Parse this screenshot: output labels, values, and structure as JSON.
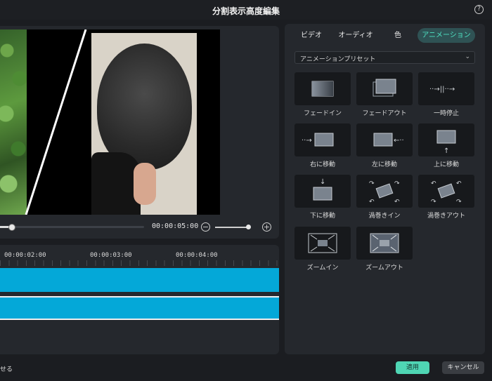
{
  "window": {
    "title": "分割表示高度編集",
    "help_icon": "?"
  },
  "preview": {
    "time_display": "00:00:05:00",
    "zoom_out_symbol": "−",
    "zoom_in_symbol": "+",
    "playhead_progress": 0.085,
    "zoom_level": 0.88
  },
  "timeline": {
    "ticks": [
      "00:00:02:00",
      "00:00:03:00",
      "00:00:04:00"
    ],
    "track_color": "#04a8d8"
  },
  "tabs": [
    {
      "label": "ビデオ"
    },
    {
      "label": "オーディオ"
    },
    {
      "label": "色"
    },
    {
      "label": "アニメーション"
    }
  ],
  "active_tab": "アニメーション",
  "preset_dropdown": {
    "label": "アニメーションプリセット",
    "chevron_icon": "chevron-down-icon"
  },
  "presets": [
    {
      "label": "フェードイン",
      "icon": "fade-in-icon"
    },
    {
      "label": "フェードアウト",
      "icon": "fade-out-icon"
    },
    {
      "label": "一時停止",
      "icon": "pause-icon"
    },
    {
      "label": "右に移動",
      "icon": "move-right-icon"
    },
    {
      "label": "左に移動",
      "icon": "move-left-icon"
    },
    {
      "label": "上に移動",
      "icon": "move-up-icon"
    },
    {
      "label": "下に移動",
      "icon": "move-down-icon"
    },
    {
      "label": "渦巻きイン",
      "icon": "swirl-in-icon"
    },
    {
      "label": "渦巻きアウト",
      "icon": "swirl-out-icon"
    },
    {
      "label": "ズームイン",
      "icon": "zoom-in-icon"
    },
    {
      "label": "ズームアウト",
      "icon": "zoom-out-icon"
    }
  ],
  "footer": {
    "left_text": "せる",
    "apply_label": "適用",
    "cancel_label": "キャンセル"
  },
  "colors": {
    "accent": "#4fd6b4",
    "active_tab_text": "#4fe3c3"
  }
}
